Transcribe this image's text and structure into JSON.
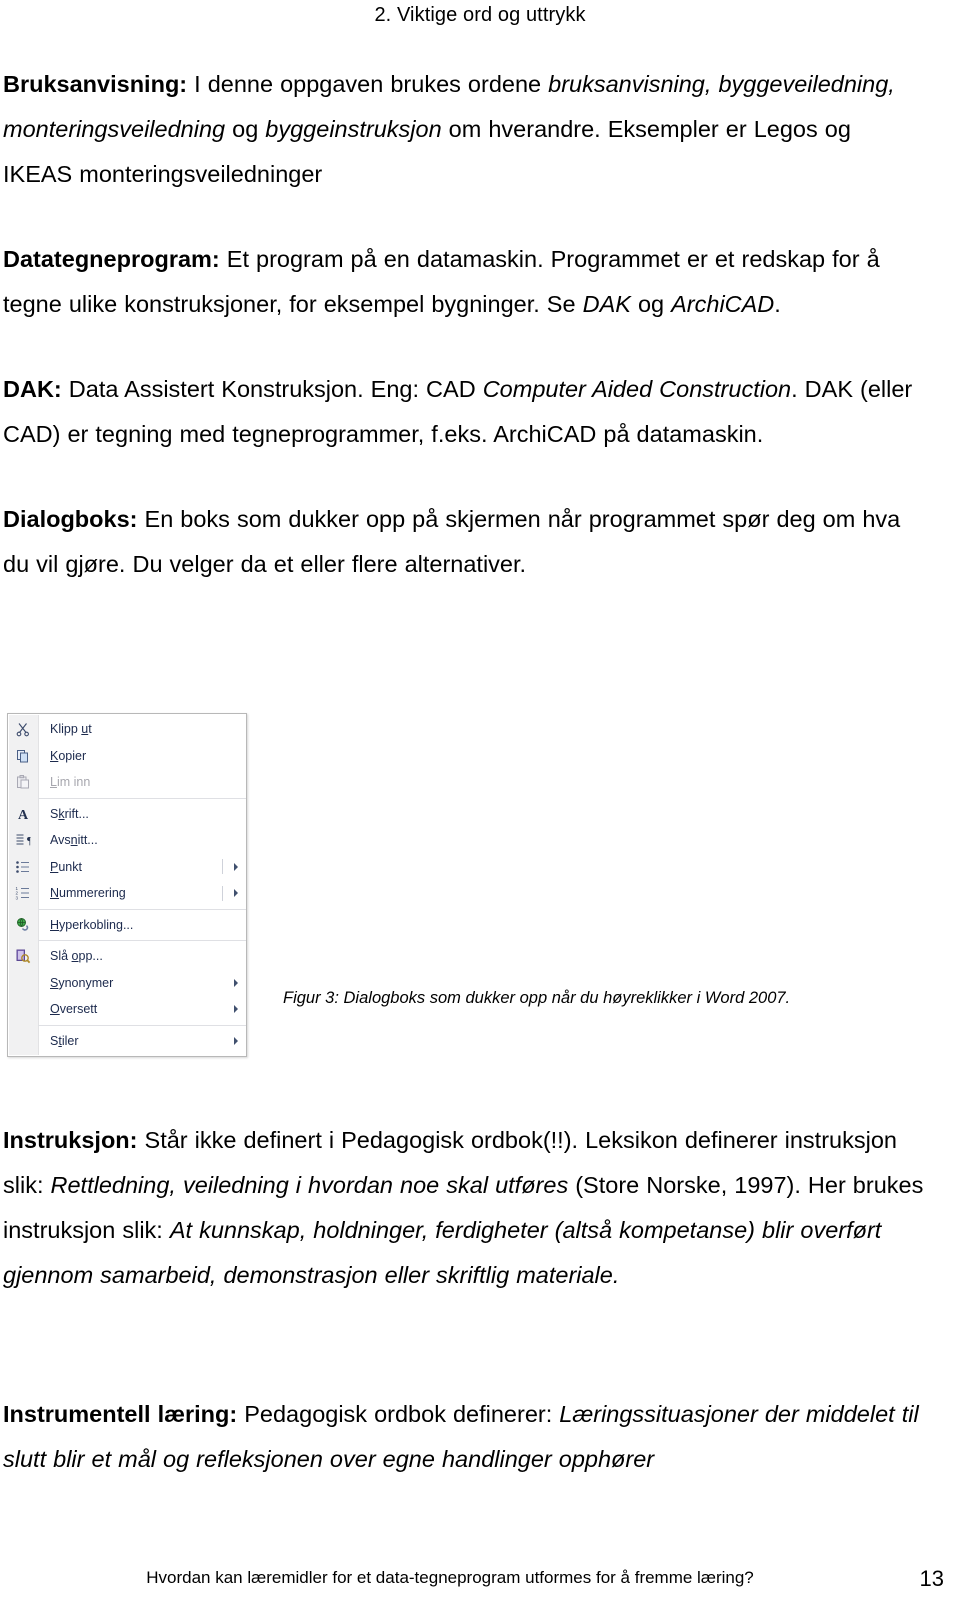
{
  "document": {
    "running_head": "2. Viktige ord og uttrykk",
    "page_number": "13",
    "footer_text": "Hvordan kan læremidler for et data-tegneprogram utformes for å fremme læring?"
  },
  "entries": [
    {
      "term": "Bruksanvisning:",
      "segments": [
        {
          "text": " I denne oppgaven brukes ordene ",
          "style": "normal"
        },
        {
          "text": "bruksanvisning, byggeveiledning, monteringsveiledning",
          "style": "italic"
        },
        {
          "text": " og ",
          "style": "normal"
        },
        {
          "text": "byggeinstruksjon",
          "style": "italic"
        },
        {
          "text": " om hverandre.  Eksempler er Legos og IKEAS monteringsveiledninger",
          "style": "normal"
        }
      ]
    },
    {
      "term": "Datategneprogram:",
      "segments": [
        {
          "text": " Et program på en datamaskin.  Programmet er et redskap for å tegne ulike konstruksjoner, for eksempel bygninger.  Se ",
          "style": "normal"
        },
        {
          "text": "DAK",
          "style": "italic"
        },
        {
          "text": " og ",
          "style": "normal"
        },
        {
          "text": "ArchiCAD",
          "style": "italic"
        },
        {
          "text": ".",
          "style": "normal"
        }
      ]
    },
    {
      "term": "DAK:",
      "segments": [
        {
          "text": " Data Assistert Konstruksjon. Eng: CAD ",
          "style": "normal"
        },
        {
          "text": "Computer Aided Construction",
          "style": "italic"
        },
        {
          "text": ".  DAK (eller CAD) er tegning med tegneprogrammer, f.eks. ArchiCAD på datamaskin.",
          "style": "normal"
        }
      ]
    },
    {
      "term": "Dialogboks:",
      "segments": [
        {
          "text": " En boks som dukker opp på skjermen når programmet spør deg om hva du vil gjøre.  Du velger da et eller flere alternativer.",
          "style": "normal"
        }
      ]
    }
  ],
  "entries_lower": [
    {
      "term": "Instruksjon:",
      "segments": [
        {
          "text": " Står ikke definert i Pedagogisk ordbok(!!).  Leksikon definerer instruksjon slik: ",
          "style": "normal"
        },
        {
          "text": "Rettledning, veiledning i hvordan noe skal utføres",
          "style": "italic"
        },
        {
          "text": " (Store Norske, 1997).  Her brukes instruksjon slik: ",
          "style": "normal"
        },
        {
          "text": "At kunnskap, holdninger, ferdigheter (altså kompetanse) blir overført gjennom samarbeid, demonstrasjon eller skriftlig materiale.",
          "style": "italic"
        }
      ]
    }
  ],
  "entries_last": [
    {
      "term": "Instrumentell læring:",
      "segments": [
        {
          "text": " Pedagogisk ordbok definerer: ",
          "style": "normal"
        },
        {
          "text": "Læringssituasjoner der middelet til slutt blir et mål og refleksjonen over egne handlinger opphører",
          "style": "italic"
        }
      ]
    }
  ],
  "figure": {
    "caption": "Figur 3: Dialogboks som dukker opp når du høyreklikker i Word 2007.",
    "context_menu": {
      "items": [
        {
          "label": "Klipp ut",
          "accel_index": 6,
          "icon": "scissors-icon",
          "disabled": false,
          "submenu": false,
          "separator_after": false
        },
        {
          "label": "Kopier",
          "accel_index": 0,
          "icon": "copy-icon",
          "disabled": false,
          "submenu": false,
          "separator_after": false
        },
        {
          "label": "Lim inn",
          "accel_index": 0,
          "icon": "paste-icon",
          "disabled": true,
          "submenu": false,
          "separator_after": true
        },
        {
          "label": "Skrift...",
          "accel_index": 1,
          "icon": "font-a-icon",
          "disabled": false,
          "submenu": false,
          "separator_after": false
        },
        {
          "label": "Avsnitt...",
          "accel_index": 3,
          "icon": "paragraph-icon",
          "disabled": false,
          "submenu": false,
          "separator_after": false
        },
        {
          "label": "Punkt",
          "accel_index": 0,
          "icon": "bullet-list-icon",
          "disabled": false,
          "submenu": true,
          "separator_after": false
        },
        {
          "label": "Nummerering",
          "accel_index": 0,
          "icon": "numbered-list-icon",
          "disabled": false,
          "submenu": true,
          "separator_after": true
        },
        {
          "label": "Hyperkobling...",
          "accel_index": 0,
          "icon": "hyperlink-icon",
          "disabled": false,
          "submenu": false,
          "separator_after": true
        },
        {
          "label": "Slå opp...",
          "accel_index": 4,
          "icon": "lookup-icon",
          "disabled": false,
          "submenu": false,
          "separator_after": false
        },
        {
          "label": "Synonymer",
          "accel_index": 0,
          "icon": "none",
          "disabled": false,
          "submenu": true,
          "separator_after": false
        },
        {
          "label": "Oversett",
          "accel_index": 0,
          "icon": "none",
          "disabled": false,
          "submenu": true,
          "separator_after": true
        },
        {
          "label": "Stiler",
          "accel_index": 1,
          "icon": "none",
          "disabled": false,
          "submenu": true,
          "separator_after": false
        }
      ]
    }
  },
  "colors": {
    "menu_text": "#1c2a4d",
    "menu_disabled_text": "#a7a7ae",
    "menu_gutter": "#f1f1f2",
    "menu_border": "#b8b8b8",
    "page_background": "#ffffff",
    "body_text": "#000000"
  }
}
